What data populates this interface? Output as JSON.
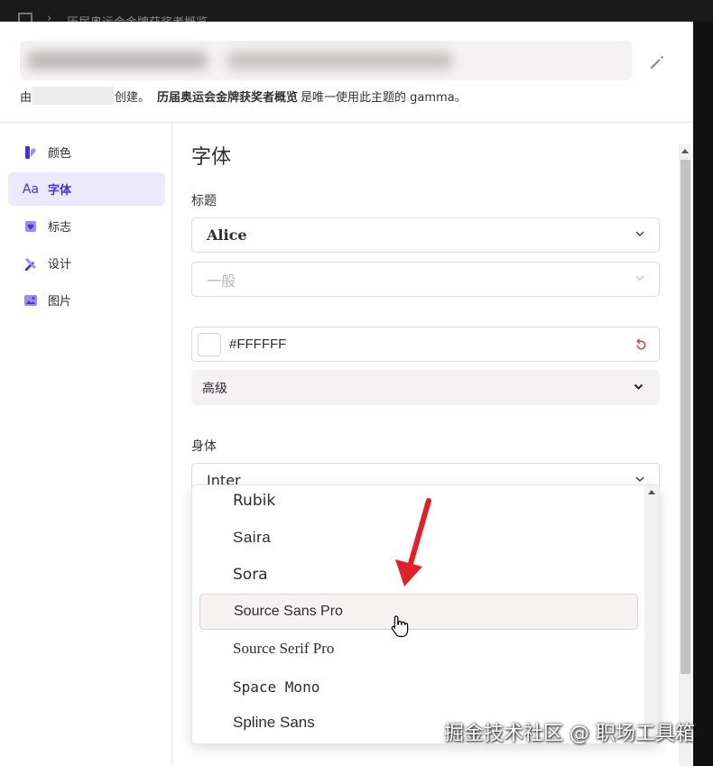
{
  "topbar": {
    "breadcrumb": "历届奥运会金牌获奖者概览"
  },
  "header": {
    "created_prefix": "由",
    "created_suffix": "创建。",
    "theme_name": "历届奥运会金牌获奖者概览",
    "usage_text": "是唯一使用此主题的 gamma。"
  },
  "sidebar": {
    "items": [
      {
        "label": "颜色",
        "icon": "palette-icon"
      },
      {
        "label": "字体",
        "icon": "font-icon"
      },
      {
        "label": "标志",
        "icon": "logo-icon"
      },
      {
        "label": "设计",
        "icon": "design-icon"
      },
      {
        "label": "图片",
        "icon": "image-icon"
      }
    ],
    "active": "字体"
  },
  "fonts": {
    "section_title": "字体",
    "heading_label": "标题",
    "heading_font": "Alice",
    "heading_weight": "一般",
    "heading_color": "#FFFFFF",
    "advanced_label": "高级",
    "body_label": "身体",
    "body_font": "Inter"
  },
  "dropdown": {
    "options": [
      "Rubik",
      "Saira",
      "Sora",
      "Source Sans Pro",
      "Source Serif Pro",
      "Space Mono",
      "Spline Sans"
    ],
    "hovered": "Source Sans Pro"
  },
  "colors": {
    "accent": "#4b2fd6",
    "arrow": "#e0202a",
    "reset": "#d23a3a"
  },
  "watermark": "掘金技术社区 @ 职场工具箱"
}
